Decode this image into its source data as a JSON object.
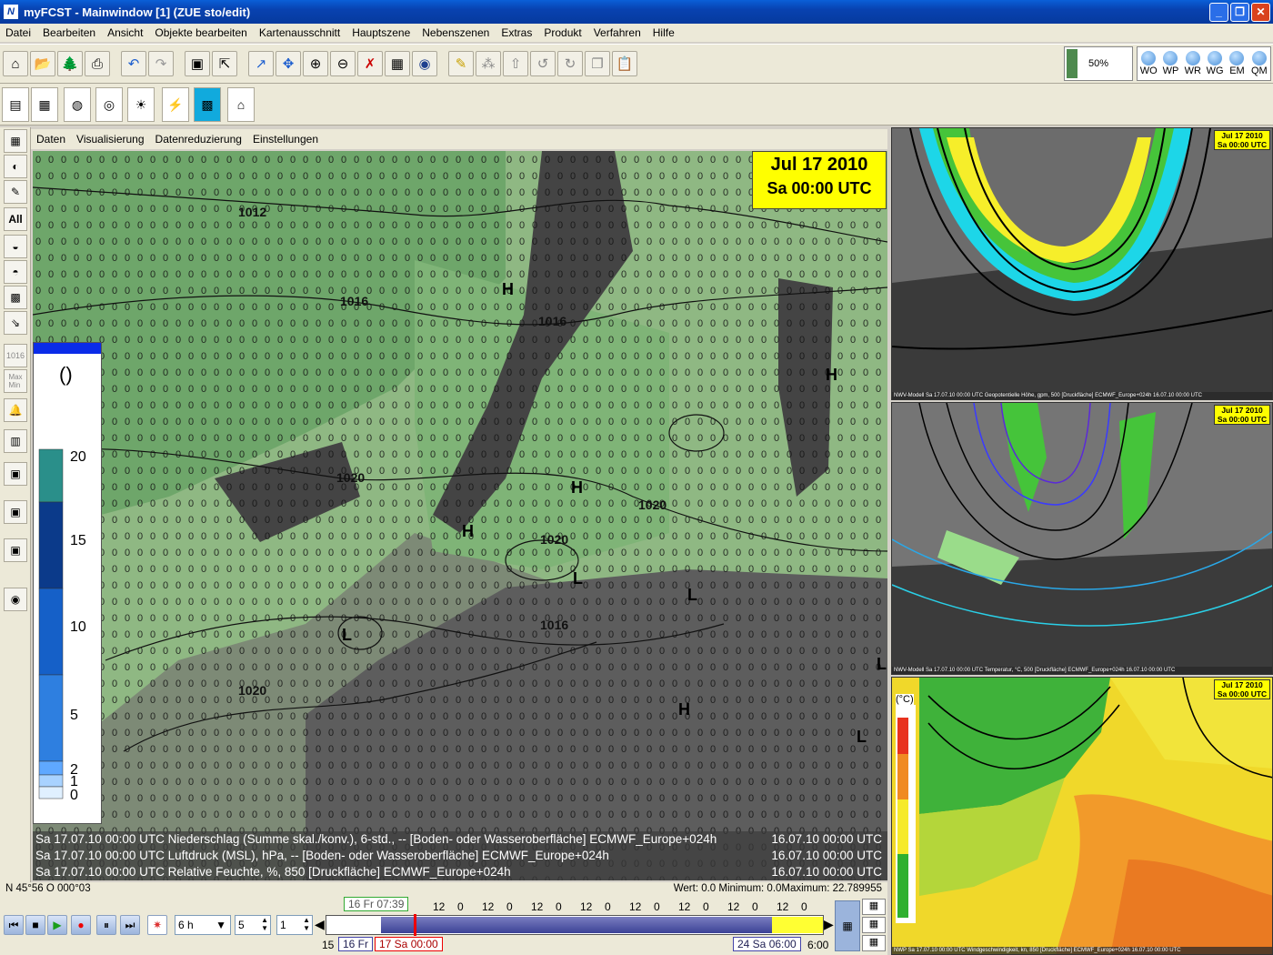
{
  "window": {
    "title": "myFCST - Mainwindow [1] (ZUE sto/edit)",
    "app_icon": "N"
  },
  "menu": [
    "Datei",
    "Bearbeiten",
    "Ansicht",
    "Objekte bearbeiten",
    "Kartenausschnitt",
    "Hauptszene",
    "Nebenszenen",
    "Extras",
    "Produkt",
    "Verfahren",
    "Hilfe"
  ],
  "toolbar": {
    "zoom_label": "50%",
    "zoom_fill": 0.5,
    "views": [
      "WO",
      "WP",
      "WR",
      "WG",
      "EM",
      "QM"
    ]
  },
  "submenu": [
    "Daten",
    "Visualisierung",
    "Datenreduzierung",
    "Einstellungen"
  ],
  "leftbar": {
    "all_label": "All",
    "maxmin_label": "Max\nMin",
    "pressure_label": "1016"
  },
  "map": {
    "date_line1": "Jul 17 2010",
    "date_line2": "Sa 00:00 UTC",
    "isobars": [
      "1012",
      "1016",
      "1016",
      "1020",
      "1020",
      "1020",
      "1016",
      "1020"
    ],
    "pressure_centers": [
      "H",
      "H",
      "H",
      "H",
      "H",
      "L",
      "L",
      "L",
      "L",
      "L"
    ],
    "info_lines": [
      {
        "left": "Sa 17.07.10 00:00 UTC   Niederschlag (Summe skal./konv.), 6-std., -- [Boden- oder Wasseroberfläche] ECMWF_Europe+024h",
        "right": "16.07.10 00:00 UTC"
      },
      {
        "left": "Sa 17.07.10 00:00 UTC   Luftdruck (MSL), hPa, -- [Boden- oder Wasseroberfläche] ECMWF_Europe+024h",
        "right": "16.07.10 00:00 UTC"
      },
      {
        "left": "Sa 17.07.10 00:00 UTC   Relative Feuchte, %, 850 [Druckfläche] ECMWF_Europe+024h",
        "right": "16.07.10 00:00 UTC"
      }
    ]
  },
  "legend": {
    "unit": "()",
    "ticks": [
      "20",
      "15",
      "10",
      "5",
      "2",
      "1",
      "0"
    ],
    "colors": [
      "#2a8f8a",
      "#0b3a8a",
      "#1560c8",
      "#2e7fe0",
      "#5fa8ff",
      "#a8d2ff",
      "#e0f0ff"
    ]
  },
  "status": {
    "coord": "N 45°56 O 000°03",
    "values": "Wert: 0.0 Minimum: 0.0Maximum: 22.789955"
  },
  "bottom": {
    "step_select": "6 h",
    "spin1": "5",
    "spin2": "1",
    "timeline_ticks": [
      "12",
      "0",
      "12",
      "0",
      "12",
      "0",
      "12",
      "0",
      "12",
      "0",
      "12",
      "0",
      "12",
      "0",
      "12",
      "0"
    ],
    "tag_top": "16 Fr 07:39",
    "tag_left_num": "15",
    "tag_fr": "16 Fr",
    "tag_current": "17 Sa 00:00",
    "tag_end": "24 Sa 06:00",
    "tag_end_suffix": "6:00"
  },
  "right_panels": [
    {
      "date1": "Jul 17 2010",
      "date2": "Sa 00:00 UTC",
      "info": "NWV-Modell  Sa 17.07.10 00:00 UTC  Geopotentielle Höhe, gpm, 500 [Druckfläche] ECMWF_Europe+024h  16.07.10 00:00 UTC"
    },
    {
      "date1": "Jul 17 2010",
      "date2": "Sa 00:00 UTC",
      "info": "NWV-Modell  Sa 17.07.10 00:00 UTC  Temperatur, °C, 500 [Druckfläche] ECMWF_Europe+024h  16.07.10 00:00 UTC"
    },
    {
      "date1": "Jul 17 2010",
      "date2": "Sa 00:00 UTC",
      "unit": "(°C)",
      "info": "NWP  Sa 17.07.10 00:00 UTC  Windgeschwindigkeit, kn, 850 [Druckfläche] ECMWF_Europe+024h  16.07.10 00:00 UTC"
    }
  ]
}
